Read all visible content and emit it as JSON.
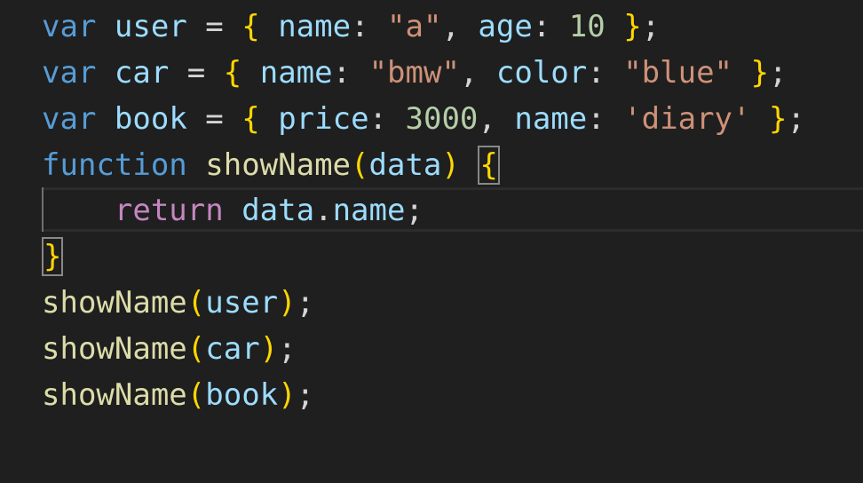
{
  "code_lines": [
    {
      "tokens": [
        {
          "t": "var",
          "c": "kw"
        },
        {
          "t": " ",
          "c": "pun"
        },
        {
          "t": "user",
          "c": "var"
        },
        {
          "t": " = ",
          "c": "pun"
        },
        {
          "t": "{",
          "c": "br1"
        },
        {
          "t": " ",
          "c": "pun"
        },
        {
          "t": "name",
          "c": "var"
        },
        {
          "t": ": ",
          "c": "pun"
        },
        {
          "t": "\"a\"",
          "c": "str"
        },
        {
          "t": ", ",
          "c": "pun"
        },
        {
          "t": "age",
          "c": "var"
        },
        {
          "t": ": ",
          "c": "pun"
        },
        {
          "t": "10",
          "c": "num"
        },
        {
          "t": " ",
          "c": "pun"
        },
        {
          "t": "}",
          "c": "br1"
        },
        {
          "t": ";",
          "c": "pun"
        }
      ]
    },
    {
      "tokens": [
        {
          "t": "var",
          "c": "kw"
        },
        {
          "t": " ",
          "c": "pun"
        },
        {
          "t": "car",
          "c": "var"
        },
        {
          "t": " = ",
          "c": "pun"
        },
        {
          "t": "{",
          "c": "br1"
        },
        {
          "t": " ",
          "c": "pun"
        },
        {
          "t": "name",
          "c": "var"
        },
        {
          "t": ": ",
          "c": "pun"
        },
        {
          "t": "\"bmw\"",
          "c": "str"
        },
        {
          "t": ", ",
          "c": "pun"
        },
        {
          "t": "color",
          "c": "var"
        },
        {
          "t": ": ",
          "c": "pun"
        },
        {
          "t": "\"blue\"",
          "c": "str"
        },
        {
          "t": " ",
          "c": "pun"
        },
        {
          "t": "}",
          "c": "br1"
        },
        {
          "t": ";",
          "c": "pun"
        }
      ]
    },
    {
      "tokens": [
        {
          "t": "var",
          "c": "kw"
        },
        {
          "t": " ",
          "c": "pun"
        },
        {
          "t": "book",
          "c": "var"
        },
        {
          "t": " = ",
          "c": "pun"
        },
        {
          "t": "{",
          "c": "br1"
        },
        {
          "t": " ",
          "c": "pun"
        },
        {
          "t": "price",
          "c": "var"
        },
        {
          "t": ": ",
          "c": "pun"
        },
        {
          "t": "3000",
          "c": "num"
        },
        {
          "t": ", ",
          "c": "pun"
        },
        {
          "t": "name",
          "c": "var"
        },
        {
          "t": ": ",
          "c": "pun"
        },
        {
          "t": "'diary'",
          "c": "str"
        },
        {
          "t": " ",
          "c": "pun"
        },
        {
          "t": "}",
          "c": "br1"
        },
        {
          "t": ";",
          "c": "pun"
        }
      ]
    },
    {
      "tokens": [
        {
          "t": "function",
          "c": "kw"
        },
        {
          "t": " ",
          "c": "pun"
        },
        {
          "t": "showName",
          "c": "fn"
        },
        {
          "t": "(",
          "c": "br1"
        },
        {
          "t": "data",
          "c": "var"
        },
        {
          "t": ")",
          "c": "br1"
        },
        {
          "t": " ",
          "c": "pun"
        },
        {
          "t": "{",
          "c": "br1",
          "box": true
        }
      ]
    },
    {
      "tokens": [
        {
          "t": "    ",
          "c": "pun"
        },
        {
          "t": "return",
          "c": "ctrl"
        },
        {
          "t": " ",
          "c": "pun"
        },
        {
          "t": "data",
          "c": "var"
        },
        {
          "t": ".",
          "c": "pun"
        },
        {
          "t": "name",
          "c": "var"
        },
        {
          "t": ";",
          "c": "pun"
        }
      ]
    },
    {
      "tokens": [
        {
          "t": "}",
          "c": "br1",
          "box": true
        }
      ]
    },
    {
      "tokens": [
        {
          "t": "showName",
          "c": "fn"
        },
        {
          "t": "(",
          "c": "br1"
        },
        {
          "t": "user",
          "c": "var"
        },
        {
          "t": ")",
          "c": "br1"
        },
        {
          "t": ";",
          "c": "pun"
        }
      ]
    },
    {
      "tokens": [
        {
          "t": "showName",
          "c": "fn"
        },
        {
          "t": "(",
          "c": "br1"
        },
        {
          "t": "car",
          "c": "var"
        },
        {
          "t": ")",
          "c": "br1"
        },
        {
          "t": ";",
          "c": "pun"
        }
      ]
    },
    {
      "tokens": [
        {
          "t": "showName",
          "c": "fn"
        },
        {
          "t": "(",
          "c": "br1"
        },
        {
          "t": "book",
          "c": "var"
        },
        {
          "t": ")",
          "c": "br1"
        },
        {
          "t": ";",
          "c": "pun"
        }
      ]
    }
  ]
}
